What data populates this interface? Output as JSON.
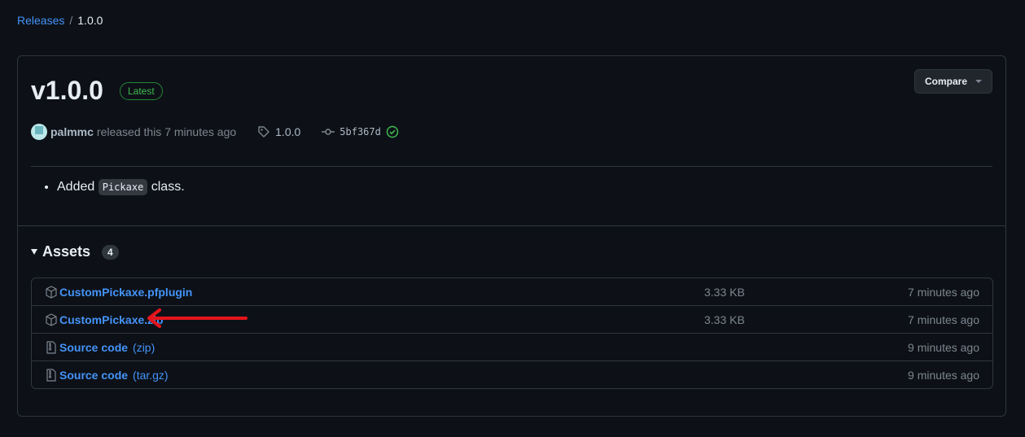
{
  "breadcrumb": {
    "parent": "Releases",
    "separator": "/",
    "current": "1.0.0"
  },
  "release": {
    "title": "v1.0.0",
    "badge": "Latest",
    "compare_label": "Compare",
    "author": "palmmc",
    "released_text": "released this 7 minutes ago",
    "tag": "1.0.0",
    "commit": "5bf367d",
    "notes": {
      "prefix": "Added",
      "code": "Pickaxe",
      "suffix": "class."
    }
  },
  "assets": {
    "title": "Assets",
    "count": "4",
    "items": [
      {
        "name": "CustomPickaxe.pfplugin",
        "sub": "",
        "size": "3.33 KB",
        "time": "7 minutes ago",
        "icon": "package-icon"
      },
      {
        "name": "CustomPickaxe.zip",
        "sub": "",
        "size": "3.33 KB",
        "time": "7 minutes ago",
        "icon": "package-icon"
      },
      {
        "name": "Source code",
        "sub": "(zip)",
        "size": "",
        "time": "9 minutes ago",
        "icon": "file-zip-icon"
      },
      {
        "name": "Source code",
        "sub": "(tar.gz)",
        "size": "",
        "time": "9 minutes ago",
        "icon": "file-zip-icon"
      }
    ]
  },
  "colors": {
    "link": "#4493f8",
    "latest": "#3fb950",
    "annotation_arrow": "#e5141b"
  }
}
